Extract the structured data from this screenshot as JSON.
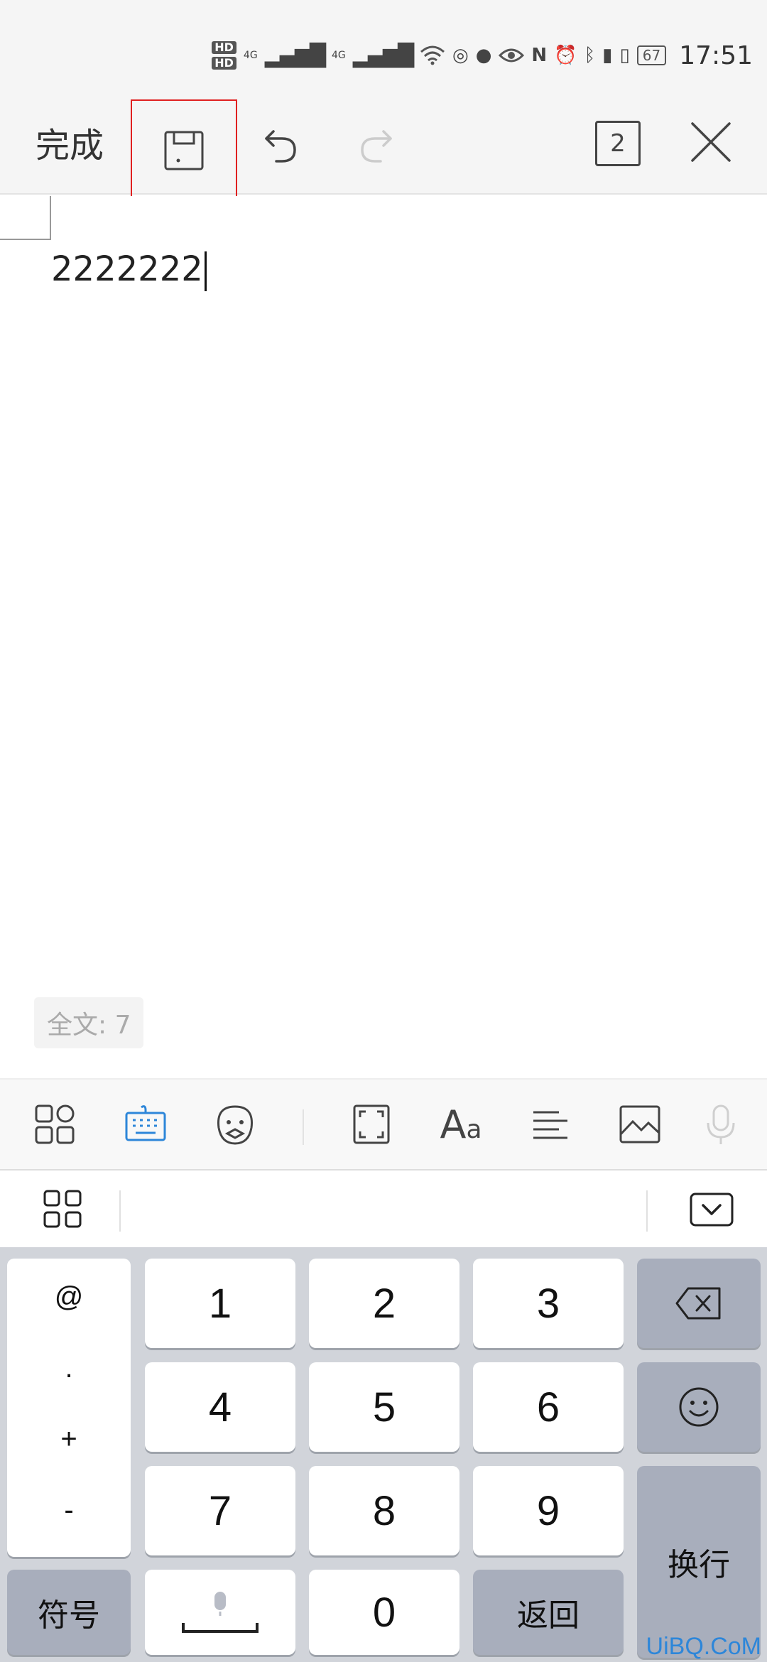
{
  "status_bar": {
    "time": "17:51",
    "battery": "67",
    "hd1": "HD",
    "hd2": "HD",
    "signal1": "4G",
    "signal2": "4G",
    "icons": [
      "hd-icon",
      "signal-4g-icon",
      "wifi-icon",
      "sync-icon",
      "chat-icon",
      "eye-icon",
      "nfc-icon",
      "alarm-icon",
      "bluetooth-icon",
      "battery-saver-icon",
      "vibrate-icon",
      "battery-icon"
    ]
  },
  "toolbar": {
    "done_label": "完成",
    "pages_count": "2",
    "icons": [
      "save-icon",
      "undo-icon",
      "redo-icon",
      "pages-icon",
      "close-icon"
    ]
  },
  "document": {
    "text": "2222222",
    "word_count": "全文: 7"
  },
  "edit_toolbar": {
    "icons": [
      "apps-icon",
      "keyboard-icon",
      "emoji-face-icon",
      "fullscreen-icon",
      "font-icon",
      "align-icon",
      "image-icon",
      "mic-icon"
    ],
    "font_label_big": "A",
    "font_label_small": "a"
  },
  "keyboard": {
    "symbols": [
      "@",
      ".",
      "+",
      "-"
    ],
    "digits": [
      "1",
      "2",
      "3",
      "4",
      "5",
      "6",
      "7",
      "8",
      "9",
      "0"
    ],
    "symbol_key": "符号",
    "enter_key": "换行",
    "back_key": "返回",
    "watermark": "UiBQ.CoM"
  },
  "colors": {
    "accent": "#2d86d9",
    "highlight_border": "#e02020",
    "keyboard_bg": "#d1d4da",
    "function_key": "#a8aebc"
  }
}
